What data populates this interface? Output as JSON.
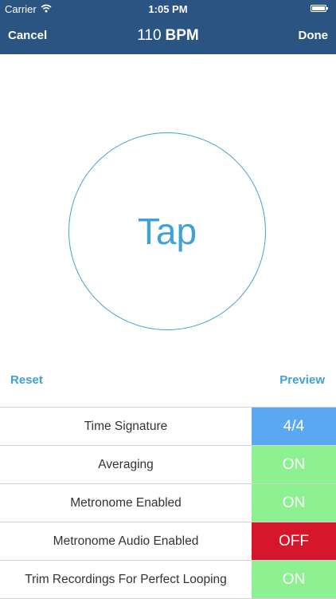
{
  "status": {
    "carrier": "Carrier",
    "time": "1:05 PM"
  },
  "nav": {
    "cancel": "Cancel",
    "bpm_value": "110",
    "bpm_unit": "BPM",
    "done": "Done"
  },
  "tap": {
    "label": "Tap"
  },
  "actions": {
    "reset": "Reset",
    "preview": "Preview"
  },
  "settings": [
    {
      "label": "Time Signature",
      "value": "4/4",
      "color": "#5aa8f1"
    },
    {
      "label": "Averaging",
      "value": "ON",
      "color": "#8ef191"
    },
    {
      "label": "Metronome Enabled",
      "value": "ON",
      "color": "#8ef191"
    },
    {
      "label": "Metronome Audio Enabled",
      "value": "OFF",
      "color": "#d6162a"
    },
    {
      "label": "Trim Recordings For Perfect Looping",
      "value": "ON",
      "color": "#8ef191"
    }
  ],
  "colors": {
    "header": "#2a5482",
    "accent": "#3fa2d6"
  },
  "icons": {
    "wifi": "wifi-icon",
    "battery": "battery-icon"
  }
}
